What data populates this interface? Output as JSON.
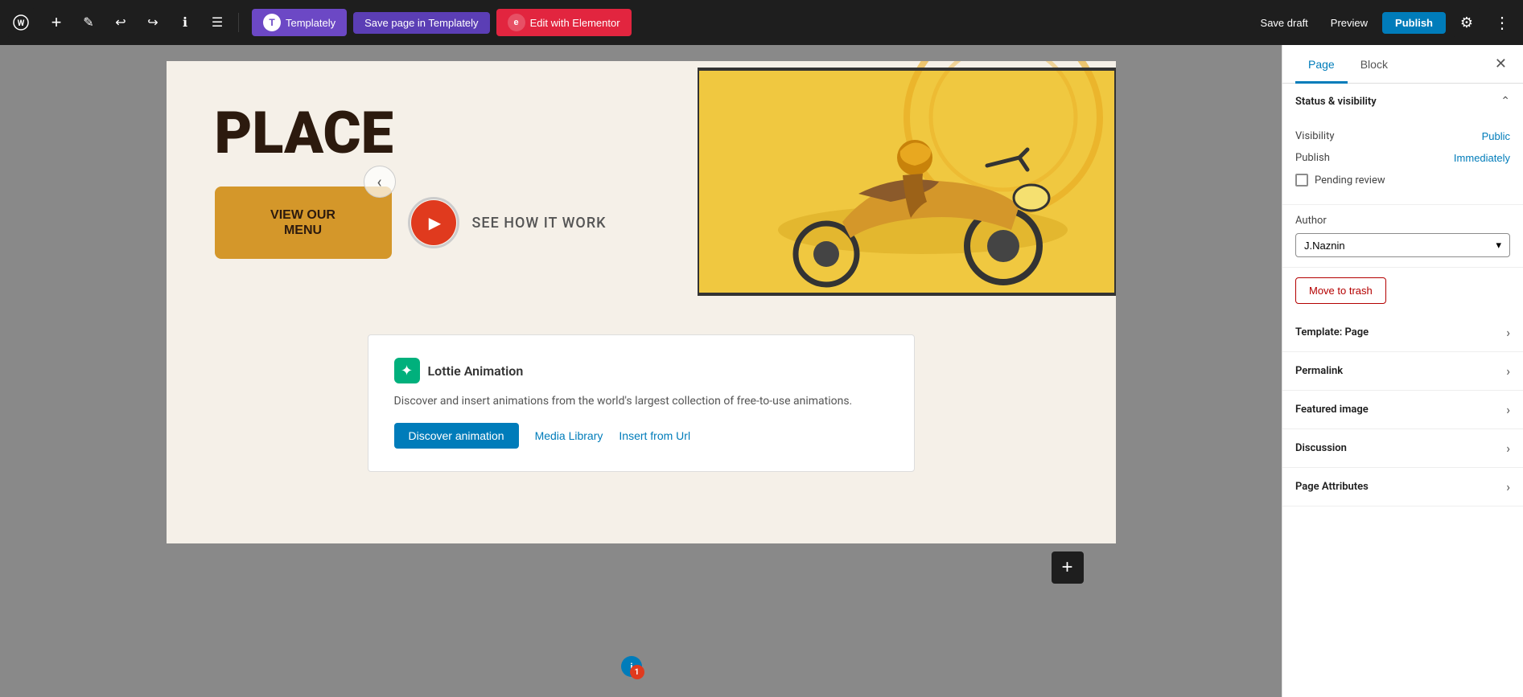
{
  "toolbar": {
    "wp_logo": "W",
    "add_label": "+",
    "edit_label": "✎",
    "undo_label": "↩",
    "redo_label": "↪",
    "info_label": "ℹ",
    "more_label": "≡",
    "templately_label": "Templately",
    "save_templately_label": "Save page in Templately",
    "elementor_label": "Edit with Elementor",
    "save_draft_label": "Save draft",
    "preview_label": "Preview",
    "publish_label": "Publish",
    "settings_label": "⚙",
    "more_opts_label": "⋮"
  },
  "page": {
    "hero": {
      "title": "PLACE",
      "view_menu_label": "VIEW OUR\nMENU",
      "see_how_label": "SEE HOW IT WORK",
      "nav_arrow": "‹"
    },
    "lottie": {
      "title": "Lottie Animation",
      "description": "Discover and insert animations from the world's largest collection of free-to-use animations.",
      "discover_label": "Discover animation",
      "media_library_label": "Media Library",
      "insert_url_label": "Insert from Url"
    },
    "add_block_label": "+"
  },
  "sidebar": {
    "tab_page_label": "Page",
    "tab_block_label": "Block",
    "close_label": "✕",
    "status_visibility": {
      "title": "Status & visibility",
      "visibility_label": "Visibility",
      "visibility_value": "Public",
      "publish_label": "Publish",
      "publish_value": "Immediately",
      "pending_review_label": "Pending review",
      "author_label": "Author",
      "author_value": "J.Naznin",
      "author_chevron": "▾"
    },
    "move_to_trash_label": "Move to trash",
    "template_label": "Template: Page",
    "permalink_label": "Permalink",
    "featured_image_label": "Featured image",
    "discussion_label": "Discussion",
    "page_attributes_label": "Page Attributes"
  },
  "notification": {
    "badge": "1"
  }
}
